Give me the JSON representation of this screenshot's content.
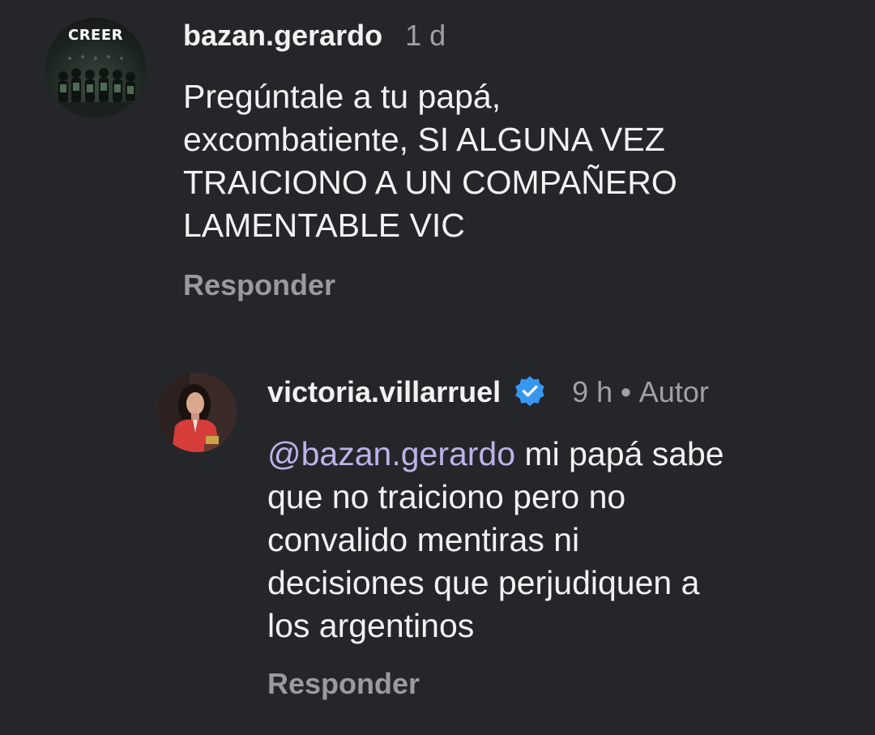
{
  "comments": [
    {
      "avatar": {
        "label": "CREER",
        "icon": "team-photo-avatar"
      },
      "username": "bazan.gerardo",
      "time": "1 d",
      "text_lines": [
        "Pregúntale a tu papá,",
        "excombatiente, SI ALGUNA VEZ",
        "TRAICIONO A UN COMPAÑERO",
        "LAMENTABLE VIC"
      ],
      "reply_label": "Responder"
    }
  ],
  "reply": {
    "avatar": {
      "icon": "profile-photo-avatar"
    },
    "username": "victoria.villarruel",
    "verified_icon": "verified-badge-icon",
    "time": "9 h",
    "separator": "•",
    "author_tag": "Autor",
    "mention": "@bazan.gerardo",
    "text_lines": [
      " mi papá sabe",
      "que no traiciono pero no",
      "convalido mentiras ni",
      "decisiones que perjudiquen a",
      "los argentinos"
    ],
    "reply_label": "Responder"
  },
  "colors": {
    "background": "#25262a",
    "primary_text": "#f2f2f2",
    "secondary_text": "#a0a0a5",
    "mention": "#b9b4e8",
    "verified": "#3797f0"
  }
}
